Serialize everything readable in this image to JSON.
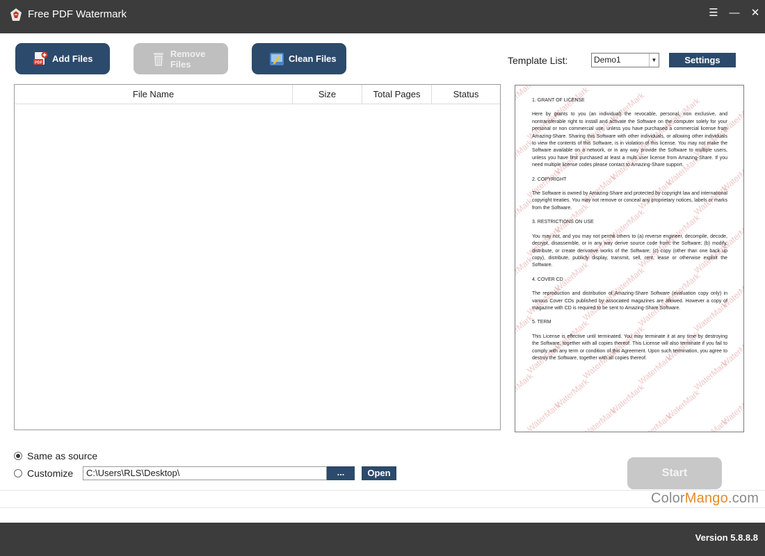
{
  "window": {
    "title": "Free PDF Watermark",
    "menu_icon": "hamburger-icon",
    "minimize_icon": "minimize-icon",
    "close_icon": "close-icon"
  },
  "toolbar": {
    "add_files": "Add Files",
    "remove_files": "Remove Files",
    "clean_files": "Clean Files"
  },
  "template": {
    "label": "Template List:",
    "selected": "Demo1",
    "settings": "Settings"
  },
  "table": {
    "columns": [
      "File Name",
      "Size",
      "Total Pages",
      "Status"
    ],
    "rows": []
  },
  "preview": {
    "watermark_text": "WaterMark",
    "sections": [
      {
        "heading": "1. GRANT OF LICENSE",
        "body": "Here by grants to you (an individual) the revocable, personal, non exclusive, and nontransferable right to install and activate the Software on the computer solely for your personal or non commercial use, unless you have purchased a commercial license from Amazing-Share. Sharing this Software with other individuals, or allowing other individuals to view the contents of this Software, is in violation of this license. You may not make the Software available on a network, or in any way provide the Software to multiple users, unless you have first purchased at least a multi user license from Amazing-Share. If you need multiple license codes please contact to Amazing-Share support."
      },
      {
        "heading": "2. COPYRIGHT",
        "body": "The Software is owned by Amazing-Share and protected by copyright law and international copyright treaties. You may not remove or conceal any proprietary notices, labels or marks from the Software."
      },
      {
        "heading": "3. RESTRICTIONS ON USE",
        "body": "You may not, and you may not permit others to (a) reverse engineer, decompile, decode, decrypt, disassemble, or in any way derive source code from, the Software; (b) modify, distribute, or create derivative works of the Software; (c) copy (other than one back up copy), distribute, publicly display, transmit, sell, rent, lease or otherwise exploit the Software."
      },
      {
        "heading": "4. COVER CD",
        "body": "The reproduction and distribution of Amazing-Share Software (evaluation copy only) in various Cover CDs published by associated magazines are allowed. However a copy of magazine with CD is required to be sent to Amazing-Share Software."
      },
      {
        "heading": "5. TERM",
        "body": "This License is effective until terminated. You may terminate it at any time by destroying the Software, together with all copies thereof. This License will also terminate if you fail to comply with any term or condition of this Agreement. Upon such termination, you agree to destroy the Software, together with all copies thereof."
      }
    ]
  },
  "output": {
    "same_as_source": "Same as source",
    "customize": "Customize",
    "path": "C:\\Users\\RLS\\Desktop\\",
    "browse": "...",
    "open": "Open",
    "selected": "same_as_source"
  },
  "start": "Start",
  "branding": {
    "part1": "Color",
    "part2": "Mango",
    "part3": ".com"
  },
  "version": "Version 5.8.8.8",
  "colors": {
    "accent": "#2c4a6b",
    "titlebar": "#3c3c3c",
    "disabled": "#c8c8c8",
    "watermark": "#dc8282"
  }
}
